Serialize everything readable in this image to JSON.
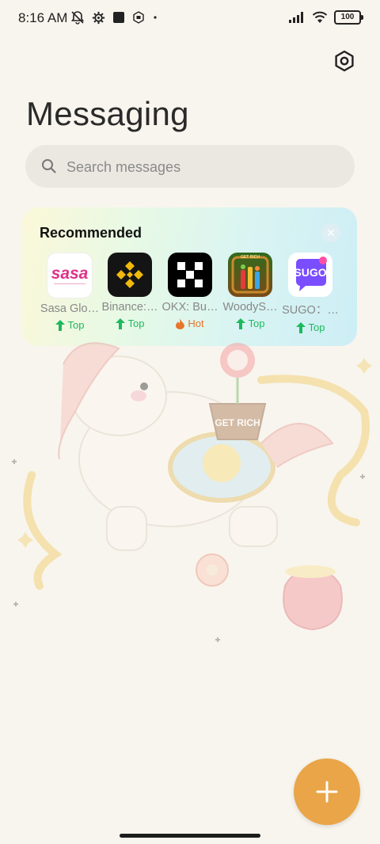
{
  "status": {
    "time": "8:16 AM",
    "battery": "100",
    "icons_left": [
      "mute-icon",
      "settings-cog-icon",
      "square-app-icon",
      "sim-icon",
      "dot-icon"
    ],
    "icons_right": [
      "signal-icon",
      "wifi-icon",
      "battery-icon"
    ]
  },
  "header": {
    "title": "Messaging"
  },
  "search": {
    "placeholder": "Search messages"
  },
  "recommended": {
    "title": "Recommended",
    "apps": [
      {
        "name": "Sasa Glo…",
        "badge": "Top",
        "badge_type": "top"
      },
      {
        "name": "Binance:…",
        "badge": "Top",
        "badge_type": "top"
      },
      {
        "name": "OKX: Bu…",
        "badge": "Hot",
        "badge_type": "hot"
      },
      {
        "name": "WoodyS…",
        "badge": "Top",
        "badge_type": "top"
      },
      {
        "name": "SUGO：…",
        "badge": "Top",
        "badge_type": "top"
      }
    ],
    "icon_texts": {
      "sasa": "sasa",
      "sugo": "SUGO",
      "woody": "GET RICH"
    }
  },
  "illustration": {
    "bag_text": "GET RICH"
  },
  "colors": {
    "accent": "#e9a548",
    "top_badge": "#1db95d",
    "hot_badge": "#e8742a",
    "background": "#f8f5ee"
  }
}
